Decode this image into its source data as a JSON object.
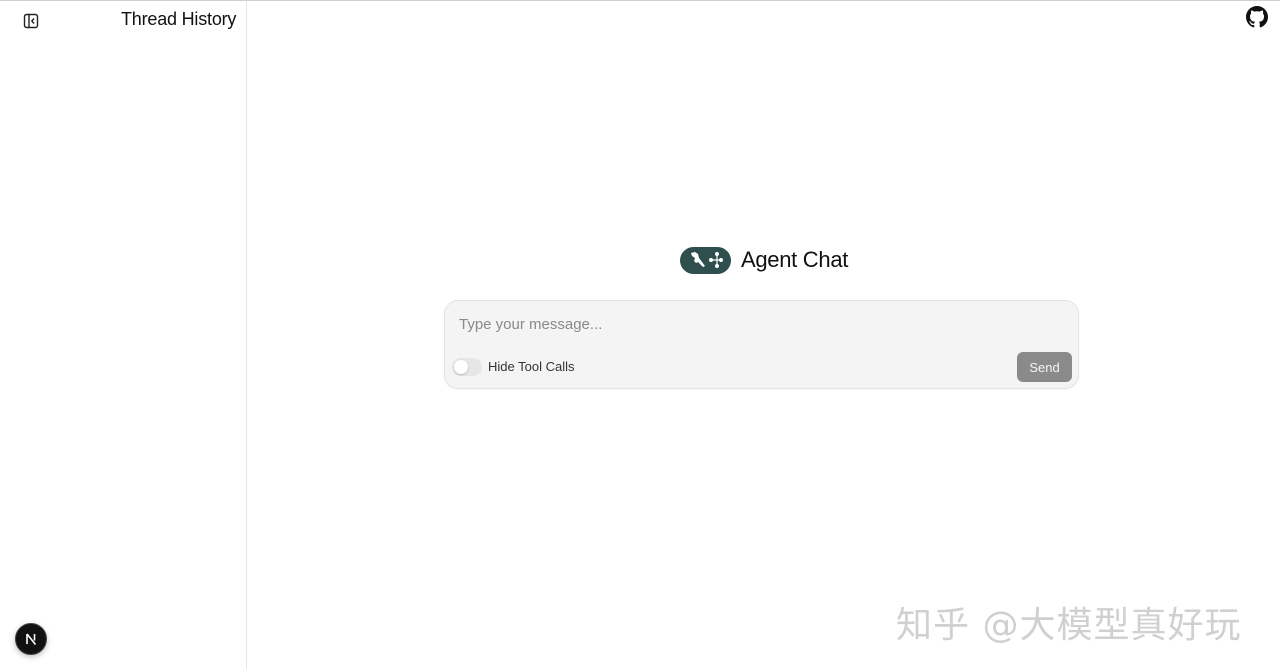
{
  "sidebar": {
    "title": "Thread History",
    "toggle_icon": "panel-left-close-icon",
    "badge_letter": "N"
  },
  "header": {
    "github_icon": "github-icon"
  },
  "main": {
    "brand_title": "Agent Chat",
    "brand_logo": "langgraph-logo-icon",
    "brand_color": "#2f4f4f"
  },
  "composer": {
    "placeholder": "Type your message...",
    "value": "",
    "toggle_label": "Hide Tool Calls",
    "toggle_on": false,
    "send_label": "Send"
  },
  "watermark": {
    "text": "知乎 @大模型真好玩"
  }
}
